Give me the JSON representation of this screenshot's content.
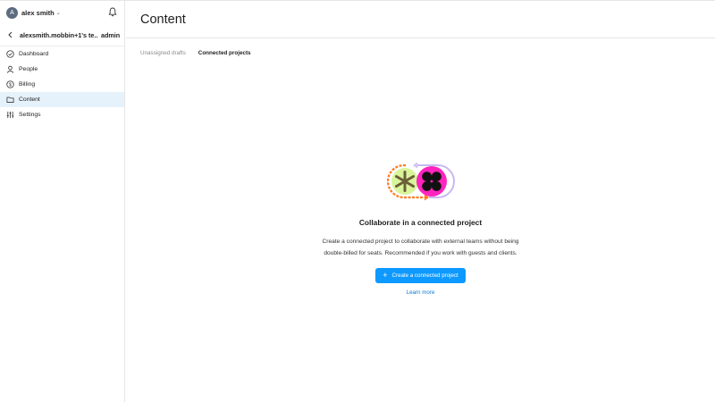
{
  "user": {
    "avatar_initial": "A",
    "name": "alex smith"
  },
  "team": {
    "name": "alexsmith.mobbin+1's te...",
    "role": "admin"
  },
  "sidebar": {
    "items": [
      {
        "label": "Dashboard",
        "icon": "check-circle-icon"
      },
      {
        "label": "People",
        "icon": "person-icon"
      },
      {
        "label": "Billing",
        "icon": "dollar-icon"
      },
      {
        "label": "Content",
        "icon": "folder-icon",
        "active": true
      },
      {
        "label": "Settings",
        "icon": "sliders-icon"
      }
    ]
  },
  "page": {
    "title": "Content",
    "tabs": [
      {
        "label": "Unassigned drafts"
      },
      {
        "label": "Connected projects",
        "active": true
      }
    ]
  },
  "empty_state": {
    "title": "Collaborate in a connected project",
    "description_line1": "Create a connected project to collaborate with external teams without being",
    "description_line2": "double-billed for seats. Recommended if you work with guests and clients.",
    "button_label": "Create a connected project",
    "link_label": "Learn more"
  },
  "colors": {
    "accent": "#0d99ff",
    "active_nav_bg": "#e6f2fb",
    "illustration_green": "#d9f59c",
    "illustration_magenta": "#ff24bd",
    "illustration_lilac": "#c9b8f2",
    "illustration_orange": "#ff7a1f"
  }
}
